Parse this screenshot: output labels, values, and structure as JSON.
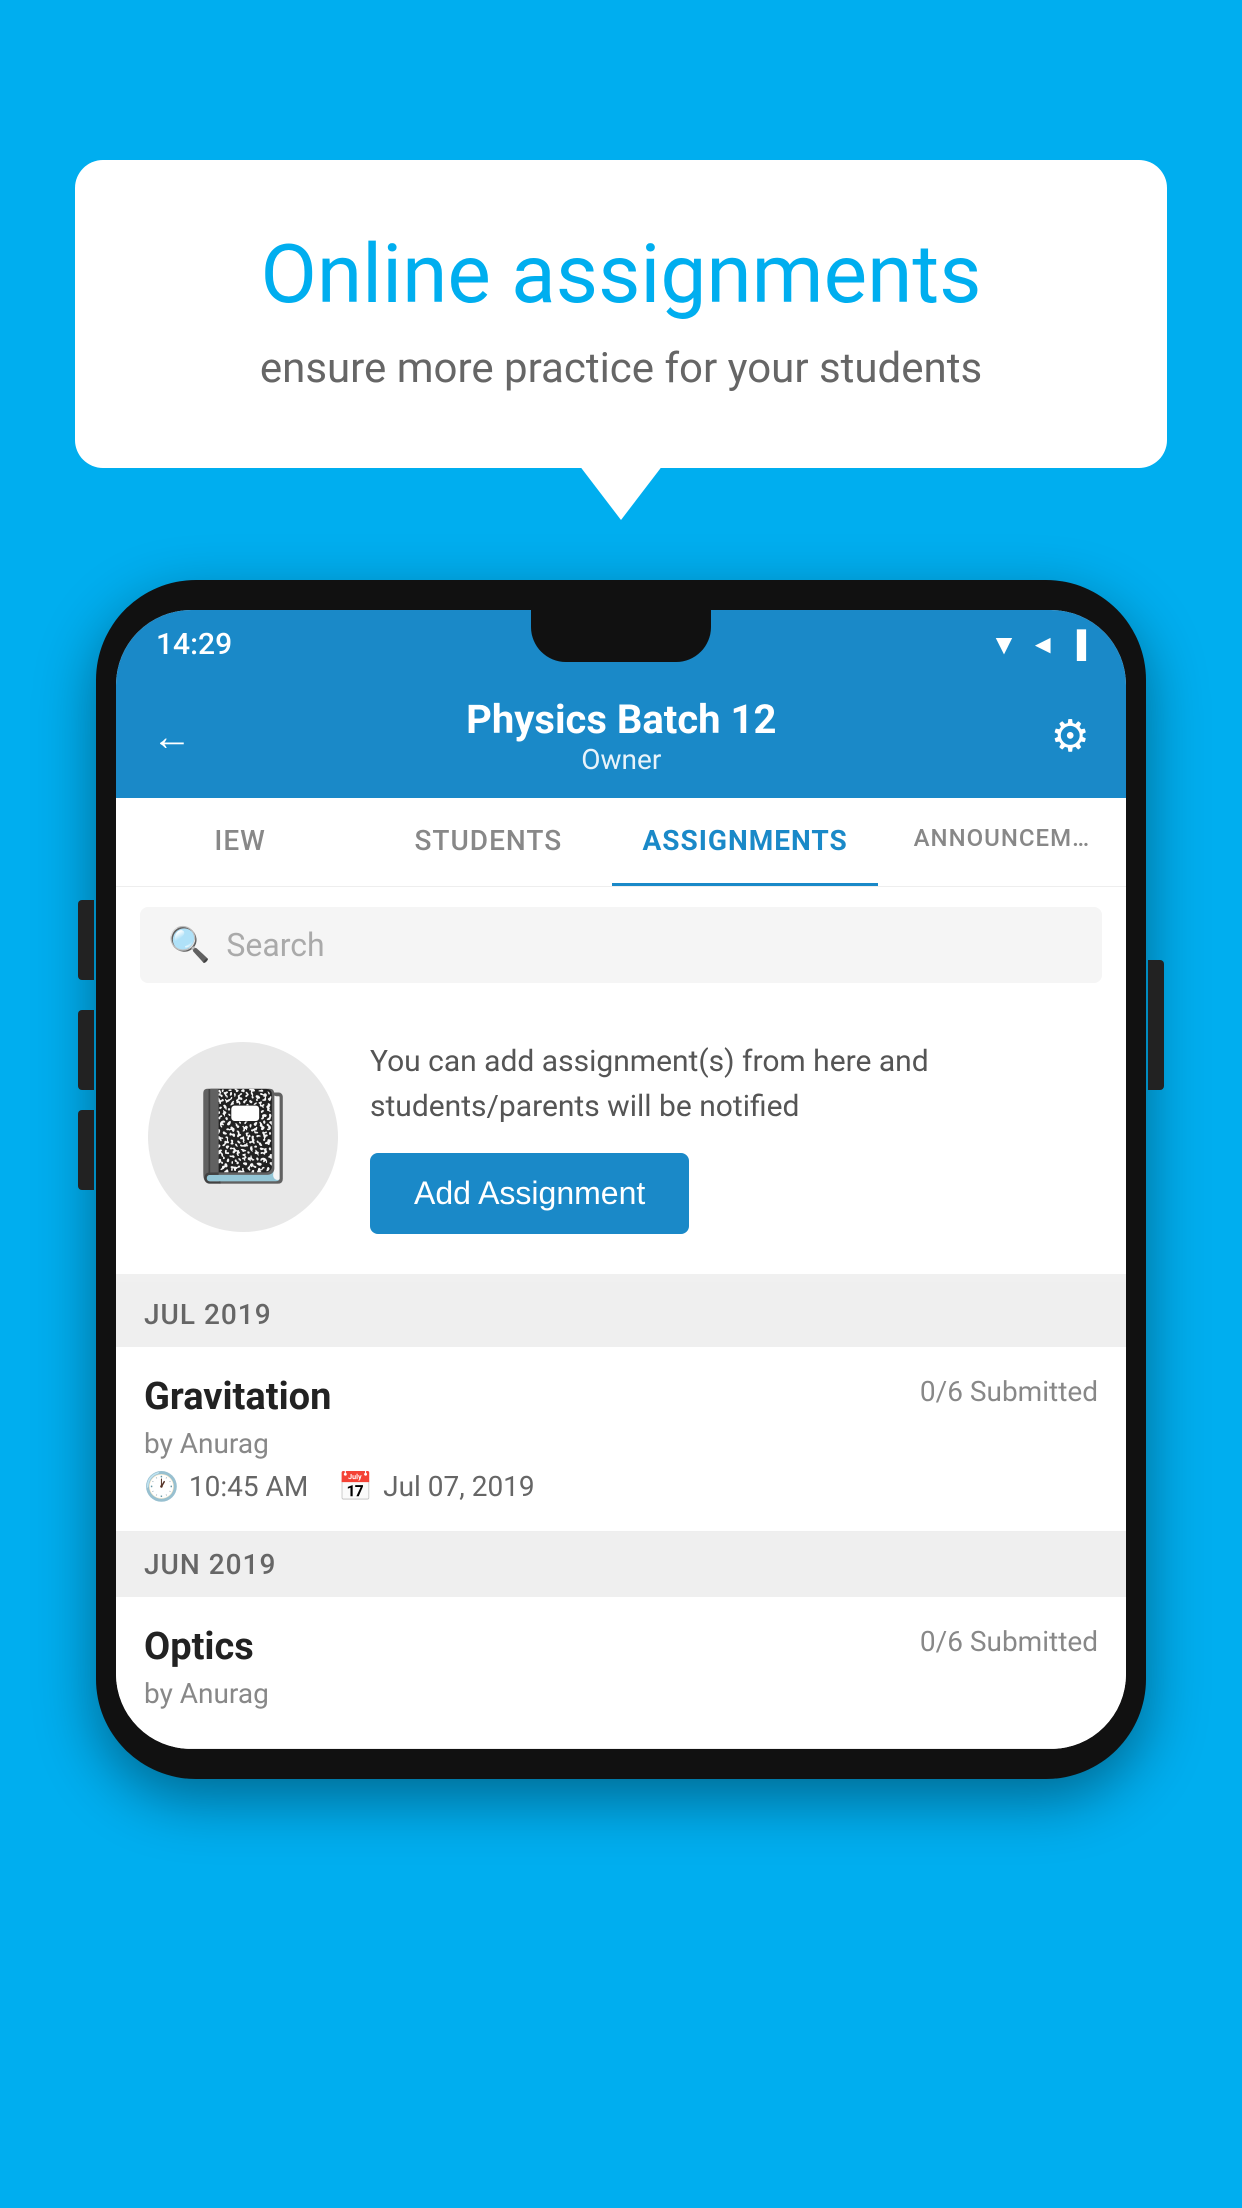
{
  "background": {
    "color": "#00AEEF"
  },
  "speech_bubble": {
    "title": "Online assignments",
    "subtitle": "ensure more practice for your students"
  },
  "status_bar": {
    "time": "14:29",
    "signal": "▼◄▐"
  },
  "header": {
    "title": "Physics Batch 12",
    "subtitle": "Owner",
    "back_label": "←",
    "gear_label": "⚙"
  },
  "tabs": [
    {
      "label": "IEW",
      "active": false
    },
    {
      "label": "STUDENTS",
      "active": false
    },
    {
      "label": "ASSIGNMENTS",
      "active": true
    },
    {
      "label": "ANNOUNCEM…",
      "active": false
    }
  ],
  "search": {
    "placeholder": "Search"
  },
  "promo": {
    "text": "You can add assignment(s) from here and students/parents will be notified",
    "button_label": "Add Assignment"
  },
  "sections": [
    {
      "label": "JUL 2019",
      "assignments": [
        {
          "name": "Gravitation",
          "submitted": "0/6 Submitted",
          "by": "by Anurag",
          "time": "10:45 AM",
          "date": "Jul 07, 2019"
        }
      ]
    },
    {
      "label": "JUN 2019",
      "assignments": [
        {
          "name": "Optics",
          "submitted": "0/6 Submitted",
          "by": "by Anurag",
          "time": "",
          "date": ""
        }
      ]
    }
  ]
}
